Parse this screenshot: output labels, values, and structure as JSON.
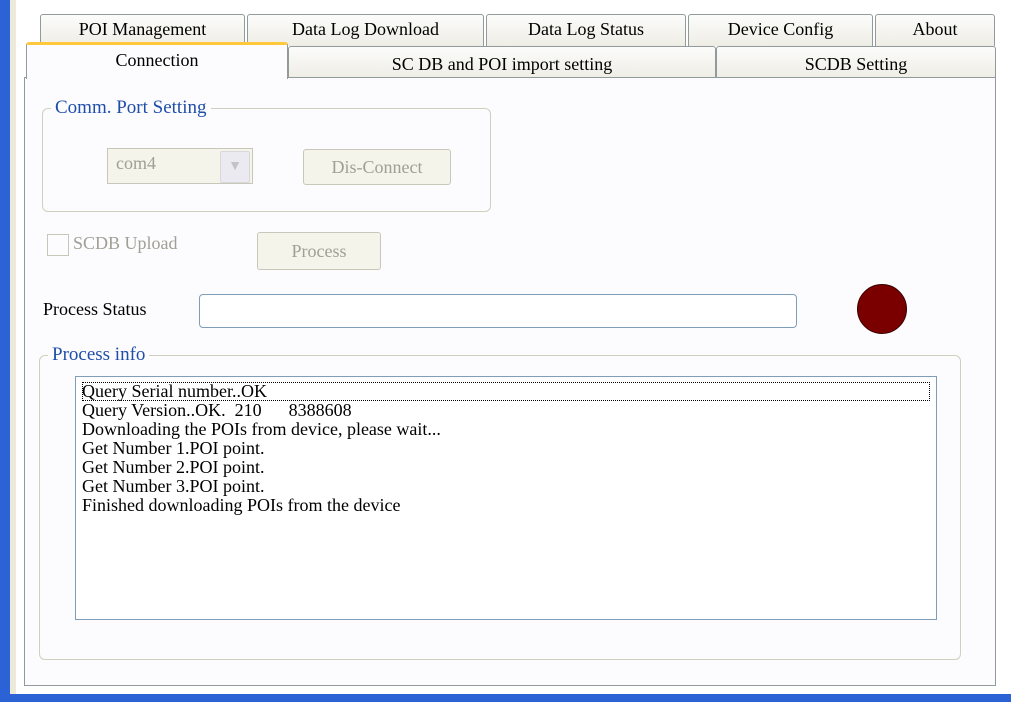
{
  "tabs_row1": [
    {
      "label": "POI Management"
    },
    {
      "label": "Data Log Download"
    },
    {
      "label": "Data Log Status"
    },
    {
      "label": "Device Config"
    },
    {
      "label": "About"
    }
  ],
  "tabs_row2": [
    {
      "label": "Connection",
      "active": true
    },
    {
      "label": "SC DB and POI import setting"
    },
    {
      "label": "SCDB  Setting"
    }
  ],
  "comm_port": {
    "title": "Comm. Port Setting",
    "port_value": "com4",
    "disconnect_label": "Dis-Connect"
  },
  "scdb_upload": {
    "label": "SCDB Upload",
    "checked": false,
    "process_label": "Process"
  },
  "process_status": {
    "label": "Process Status",
    "value": "",
    "indicator_color": "#7a0000"
  },
  "process_info": {
    "title": "Process info",
    "lines": [
      "Query Serial number..OK",
      "Query Version..OK.  210      8388608",
      "Downloading the POIs from device, please wait...",
      "Get Number 1.POI point.",
      "Get Number 2.POI point.",
      "Get Number 3.POI point.",
      "Finished downloading POIs from the device"
    ]
  }
}
